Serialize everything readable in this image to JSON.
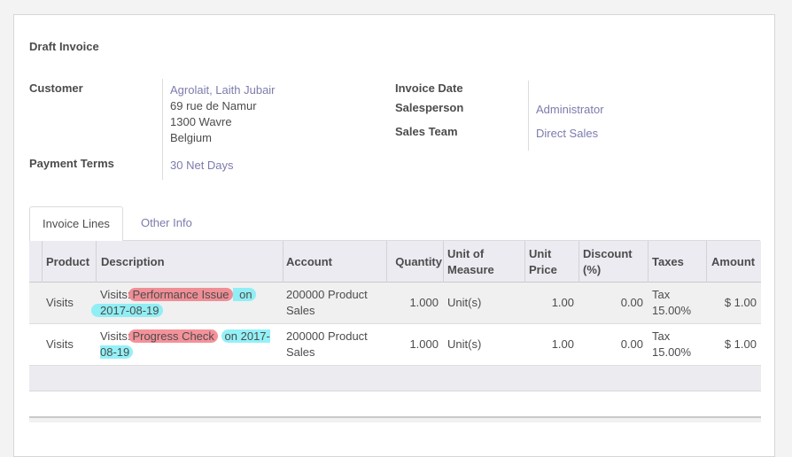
{
  "form": {
    "title": "Draft Invoice",
    "customer": {
      "label": "Customer",
      "name": "Agrolait, Laith Jubair",
      "address": [
        "69 rue de Namur",
        "1300 Wavre",
        "Belgium"
      ]
    },
    "payment_terms": {
      "label": "Payment Terms",
      "value": "30 Net Days"
    },
    "invoice_date": {
      "label": "Invoice Date",
      "value": ""
    },
    "salesperson": {
      "label": "Salesperson",
      "value": "Administrator"
    },
    "sales_team": {
      "label": "Sales Team",
      "value": "Direct Sales"
    }
  },
  "tabs": [
    {
      "label": "Invoice Lines",
      "active": true
    },
    {
      "label": "Other Info",
      "active": false
    }
  ],
  "table": {
    "headers": {
      "product": "Product",
      "description": "Description",
      "account": "Account",
      "quantity": "Quantity",
      "uom": "Unit of Measure",
      "unit_price": "Unit Price",
      "discount": "Discount (%)",
      "taxes": "Taxes",
      "amount": "Amount"
    },
    "rows": [
      {
        "product": "Visits",
        "desc_prefix": "Visits:",
        "desc_highlight_red": "Performance Issue",
        "desc_plain": " on",
        "desc_highlight_cyan": "2017-08-19",
        "account": "200000 Product Sales",
        "quantity": "1.000",
        "uom": "Unit(s)",
        "unit_price": "1.00",
        "discount": "0.00",
        "taxes": "Tax 15.00%",
        "amount": "$ 1.00"
      },
      {
        "product": "Visits",
        "desc_prefix": "Visits:",
        "desc_highlight_red": "Progress Check",
        "desc_plain": "",
        "desc_highlight_cyan": "on 2017-08-19",
        "account": "200000 Product Sales",
        "quantity": "1.000",
        "uom": "Unit(s)",
        "unit_price": "1.00",
        "discount": "0.00",
        "taxes": "Tax 15.00%",
        "amount": "$ 1.00"
      }
    ]
  },
  "colors": {
    "link": "#7c7bad",
    "highlight_red": "#f06e78",
    "highlight_cyan": "#78eef5"
  }
}
